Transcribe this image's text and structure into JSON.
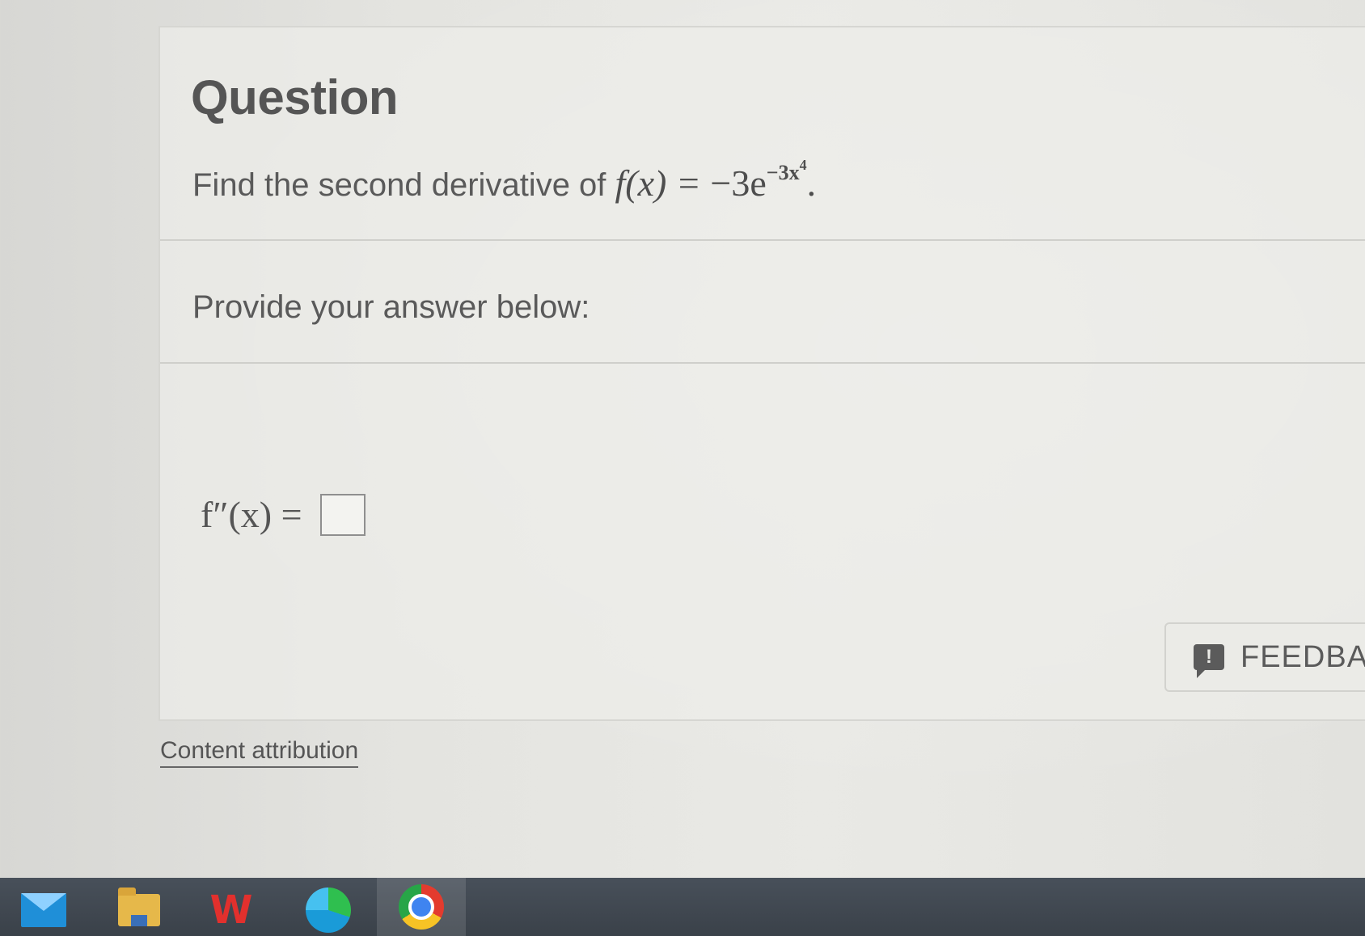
{
  "question": {
    "heading": "Question",
    "text": "Find the second derivative of ",
    "function_lhs": "f(x) = ",
    "function_coef": "−3e",
    "exponent": "−3x",
    "exponent_power": "4",
    "period": "."
  },
  "prompt": {
    "text": "Provide your answer below:"
  },
  "answer": {
    "label": "f″(x) =",
    "value": ""
  },
  "feedback": {
    "label": "FEEDBA",
    "icon": "feedback-icon"
  },
  "attribution": {
    "label": "Content attribution"
  },
  "taskbar": {
    "apps": [
      "mail-icon",
      "file-explorer-icon",
      "wps-office-icon",
      "edge-icon",
      "chrome-icon"
    ]
  }
}
